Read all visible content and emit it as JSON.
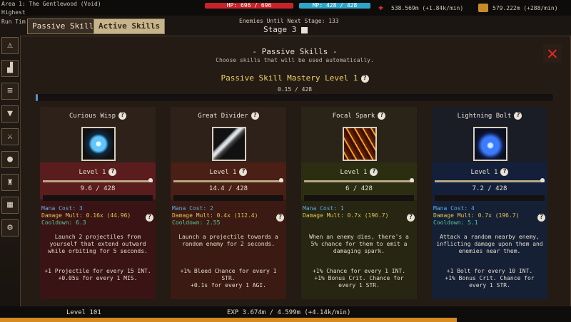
{
  "hud": {
    "area_line": "Area 1: The Gentlewood (Void)",
    "highest_line": "Highest",
    "run_line": "Run Tim",
    "hp": "HP: 696 / 696",
    "mp": "MP: 428 / 428",
    "enemies": "Enemies Until Next Stage: 133",
    "stage": "Stage 3",
    "gold_value": "538.569m (+1.84k/min)",
    "wood_value": "579.222m (+288/min)",
    "colors": {
      "hp": "#c8232a",
      "mp": "#2fa4c8"
    }
  },
  "tabs": [
    {
      "label": "Passive Skills"
    },
    {
      "label": "Active Skills"
    }
  ],
  "sidebar_icons": [
    "warning-icon",
    "boot-icon",
    "scroll-icon",
    "helmet-icon",
    "swords-icon",
    "orb-icon",
    "trophy-icon",
    "map-icon",
    "gear-icon"
  ],
  "panel": {
    "title": "- Passive Skills -",
    "subtitle": "Choose skills that will be used automatically.",
    "close_glyph": "✕",
    "mastery_title": "Passive Skill Mastery Level 1",
    "mastery_xp": "0.15 / 428",
    "mastery_progress": 0.0004
  },
  "cards": [
    {
      "name": "Curious Wisp",
      "level": "Level 1",
      "xp": "9.6 / 428",
      "mana": "Mana Cost: 3",
      "damage": "Damage Mult: 0.16x (44.96)",
      "cooldown": "Cooldown: 6.3",
      "desc": "Launch 2 projectiles from yourself that extend outward while orbiting for 5 seconds.",
      "bonus1": "+1 Projectile for every 15 INT.",
      "bonus2": "+0.05s for every 1 MIS.",
      "icon": "wisp-icon",
      "theme": {
        "head": "#2e211a",
        "band": "#5a1c1c",
        "lower": "#3a1414"
      }
    },
    {
      "name": "Great Divider",
      "level": "Level 1",
      "xp": "14.4 / 428",
      "mana": "Mana Cost: 2",
      "damage": "Damage Mult: 0.4x (112.4)",
      "cooldown": "Cooldown: 2.55",
      "desc": "Launch a projectile towards a random enemy for 2 seconds.",
      "bonus1": "+1% Bleed Chance for every 1 STR.",
      "bonus2": "+0.1s for every 1 AGI.",
      "icon": "blade-icon",
      "theme": {
        "head": "#2e211a",
        "band": "#4a1f16",
        "lower": "#3a1a12"
      }
    },
    {
      "name": "Focal Spark",
      "level": "Level 1",
      "xp": "6 / 428",
      "mana": "Mana Cost: 1",
      "damage": "Damage Mult: 0.7x (196.7)",
      "cooldown": "",
      "desc": "When an enemy dies, there's a 5% chance for them to emit a damaging spark.",
      "bonus1": "+1% Chance for every 1 INT.",
      "bonus2": "+1% Bonus Crit. Chance for every 1 STR.",
      "icon": "spark-icon",
      "theme": {
        "head": "#2a2418",
        "band": "#2c2e12",
        "lower": "#262612"
      }
    },
    {
      "name": "Lightning Bolt",
      "level": "Level 1",
      "xp": "7.2 / 428",
      "mana": "Mana Cost: 4",
      "damage": "Damage Mult: 0.7x (196.7)",
      "cooldown": "Cooldown: 5.1",
      "desc": "Attack a random nearby enemy, inflicting damage upon them and enemies near them.",
      "bonus1": "+1 Bolt for every 10 INT.",
      "bonus2": "+1% Bonus Crit. Chance for every 1 STR.",
      "icon": "lightning-icon",
      "theme": {
        "head": "#1a1c26",
        "band": "#14203a",
        "lower": "#152035"
      }
    }
  ],
  "bottom": {
    "level": "Level 101",
    "exp": "EXP 3.674m / 4.599m (+4.14k/min)",
    "exp_progress": 0.8
  }
}
